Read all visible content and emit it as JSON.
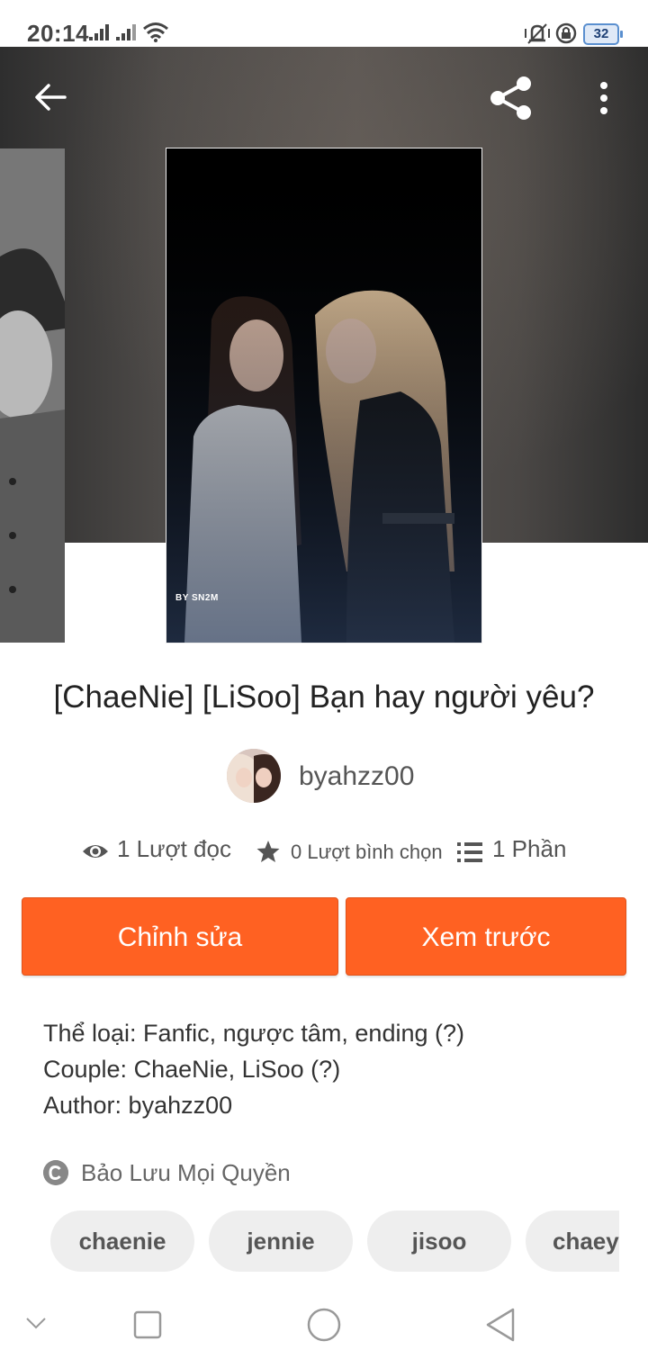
{
  "status_bar": {
    "time": "20:14",
    "battery": "32"
  },
  "story": {
    "title": "[ChaeNie] [LiSoo] Bạn hay người yêu?",
    "author": "byahzz00",
    "cover_watermark": "BY SN2M",
    "stats": {
      "reads": "1 Lượt đọc",
      "votes": "0 Lượt bình chọn",
      "parts": "1 Phần"
    },
    "description_lines": [
      "Thể loại: Fanfic, ngược tâm, ending (?)",
      "Couple: ChaeNie, LiSoo (?)",
      "Author: byahzz00"
    ],
    "copyright": "Bảo Lưu Mọi Quyền",
    "tags": [
      "chaenie",
      "jennie",
      "jisoo",
      "chaey"
    ]
  },
  "actions": {
    "edit": "Chỉnh sửa",
    "preview": "Xem trước"
  },
  "colors": {
    "accent": "#ff6122",
    "tag_bg": "#eeeeee",
    "text_primary": "#222222",
    "text_secondary": "#555555"
  },
  "icons": {
    "back": "arrow-left-icon",
    "share": "share-icon",
    "more": "more-vertical-icon",
    "reads": "eye-icon",
    "votes": "star-icon",
    "parts": "list-icon",
    "copyright": "copyright-icon"
  }
}
